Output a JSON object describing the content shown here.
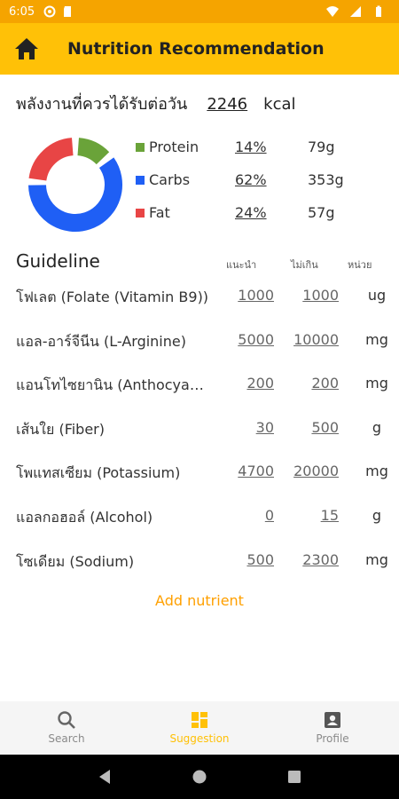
{
  "status_bar": {
    "time": "6:05"
  },
  "app_bar": {
    "title": "Nutrition Recommendation"
  },
  "energy": {
    "label": "พลังงานที่ควรได้รับต่อวัน",
    "value": "2246",
    "unit": "kcal"
  },
  "macros": [
    {
      "name": "Protein",
      "percent": "14%",
      "grams": "79g",
      "color": "#6aa339",
      "fraction": 0.14
    },
    {
      "name": "Carbs",
      "percent": "62%",
      "grams": "353g",
      "color": "#1f5ff5",
      "fraction": 0.62
    },
    {
      "name": "Fat",
      "percent": "24%",
      "grams": "57g",
      "color": "#e84545",
      "fraction": 0.24
    }
  ],
  "guideline": {
    "title": "Guideline",
    "col_recommended": "แนะนำ",
    "col_max": "ไม่เกิน",
    "col_unit": "หน่วย",
    "rows": [
      {
        "name": "โฟเลต (Folate (Vitamin B9))",
        "recommended": "1000",
        "max": "1000",
        "unit": "ug"
      },
      {
        "name": "แอล-อาร์จีนีน (L-Arginine)",
        "recommended": "5000",
        "max": "10000",
        "unit": "mg"
      },
      {
        "name": "แอนโทไซยานิน (Anthocyanin)",
        "recommended": "200",
        "max": "200",
        "unit": "mg"
      },
      {
        "name": "เส้นใย (Fiber)",
        "recommended": "30",
        "max": "500",
        "unit": "g"
      },
      {
        "name": "โพแทสเซียม (Potassium)",
        "recommended": "4700",
        "max": "20000",
        "unit": "mg"
      },
      {
        "name": "แอลกอฮอล์ (Alcohol)",
        "recommended": "0",
        "max": "15",
        "unit": "g"
      },
      {
        "name": "โซเดียม (Sodium)",
        "recommended": "500",
        "max": "2300",
        "unit": "mg"
      }
    ]
  },
  "add_nutrient_label": "Add nutrient",
  "bottom_nav": [
    {
      "label": "Search",
      "icon": "search-icon",
      "active": false
    },
    {
      "label": "Suggestion",
      "icon": "dashboard-icon",
      "active": true
    },
    {
      "label": "Profile",
      "icon": "profile-icon",
      "active": false
    }
  ],
  "colors": {
    "accent": "#ffc107",
    "status_bar": "#f5a400",
    "link": "#ffa000"
  }
}
